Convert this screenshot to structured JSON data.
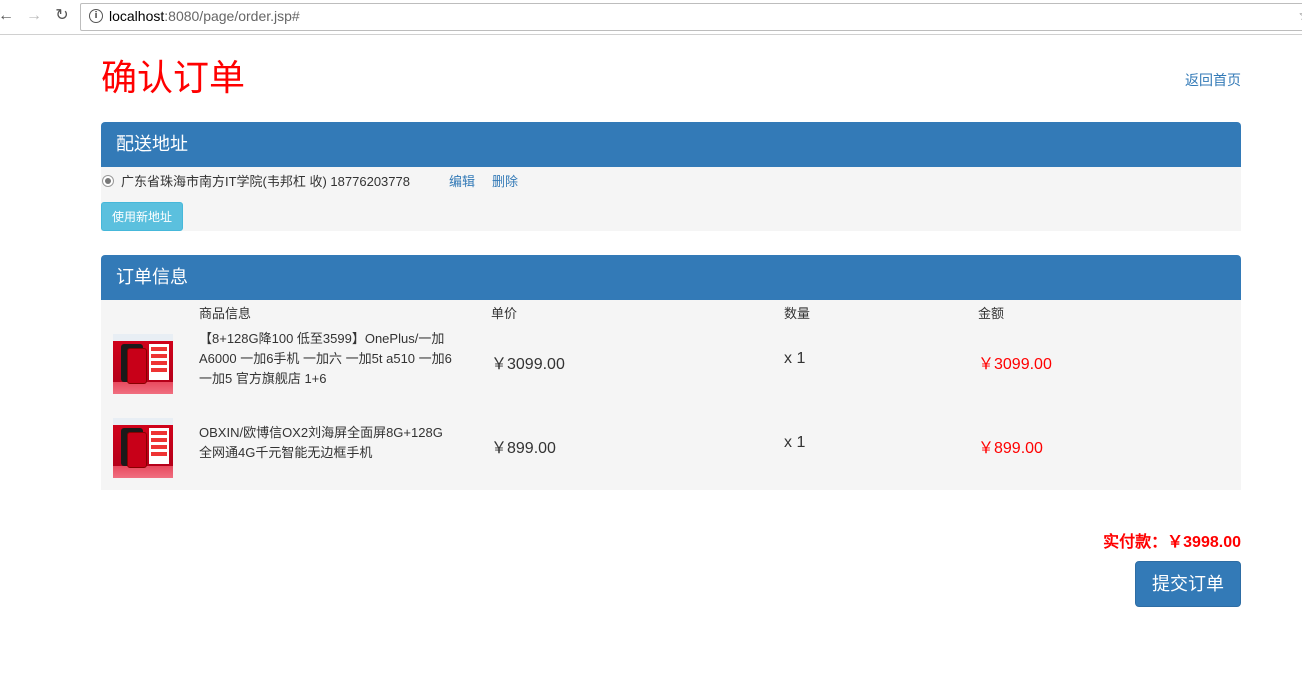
{
  "browser": {
    "url_host": "localhost",
    "url_rest": ":8080/page/order.jsp#"
  },
  "page": {
    "title": "确认订单",
    "back_home": "返回首页"
  },
  "address_panel": {
    "heading": "配送地址",
    "address": {
      "text": "广东省珠海市南方IT学院(韦邦杠 收) 18776203778",
      "edit": "编辑",
      "delete": "删除",
      "selected": true
    },
    "new_address_button": "使用新地址"
  },
  "order_panel": {
    "heading": "订单信息",
    "columns": [
      "商品信息",
      "单价",
      "数量",
      "金额"
    ],
    "items": [
      {
        "name": "【8+128G降100 低至3599】OnePlus/一加 A6000 一加6手机 一加六 一加5t a510 一加6 一加5 官方旗舰店 1+6",
        "price": "￥3099.00",
        "qty": "x 1",
        "amount": "￥3099.00"
      },
      {
        "name": "OBXIN/欧博信OX2刘海屏全面屏8G+128G全网通4G千元智能无边框手机",
        "price": "￥899.00",
        "qty": "x 1",
        "amount": "￥899.00"
      }
    ]
  },
  "summary": {
    "total": "实付款：￥3998.00",
    "submit": "提交订单"
  },
  "colors": {
    "primary": "#337ab7",
    "info": "#5bc0de",
    "danger": "#ff0000",
    "panel_bg": "#f5f5f5"
  }
}
